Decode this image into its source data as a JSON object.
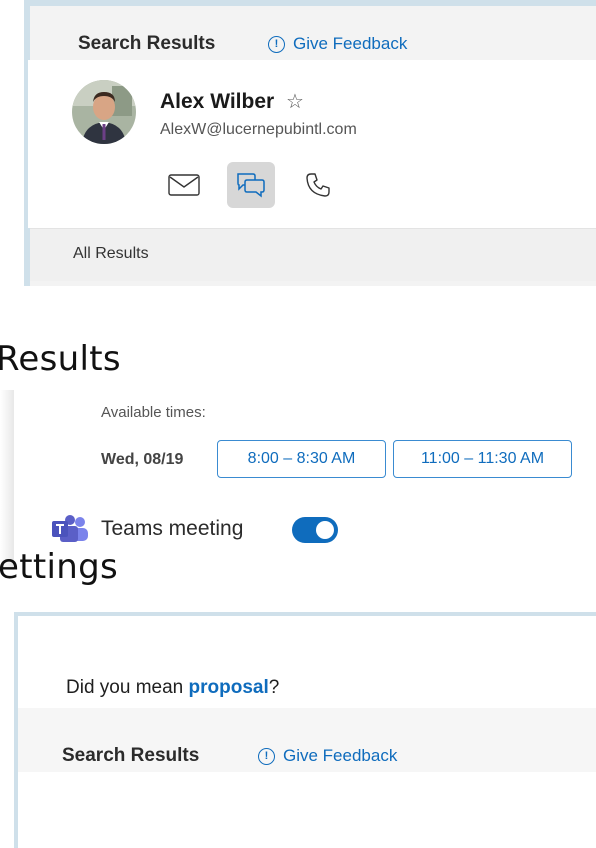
{
  "panel1": {
    "title": "Search Results",
    "feedback_label": "Give Feedback",
    "person": {
      "name": "Alex Wilber",
      "email": "AlexW@lucernepubintl.com"
    },
    "actions": [
      "mail-icon",
      "chat-icon",
      "phone-icon"
    ],
    "all_results_label": "All Results"
  },
  "heading_results": "Results",
  "panel2": {
    "available_label": "Available times:",
    "date": "Wed, 08/19",
    "slots": [
      "8:00 – 8:30 AM",
      "11:00 – 11:30 AM"
    ],
    "teams_label": "Teams meeting",
    "teams_enabled": true
  },
  "heading_settings": "ettings",
  "panel3": {
    "did_you_mean_prefix": "Did you mean ",
    "suggestion": "proposal",
    "did_you_mean_suffix": "?",
    "title": "Search Results",
    "feedback_label": "Give Feedback"
  },
  "colors": {
    "accent": "#0f6cbd",
    "panel_border": "#cfe0ea",
    "teams_purple": "#5b5fc7"
  }
}
